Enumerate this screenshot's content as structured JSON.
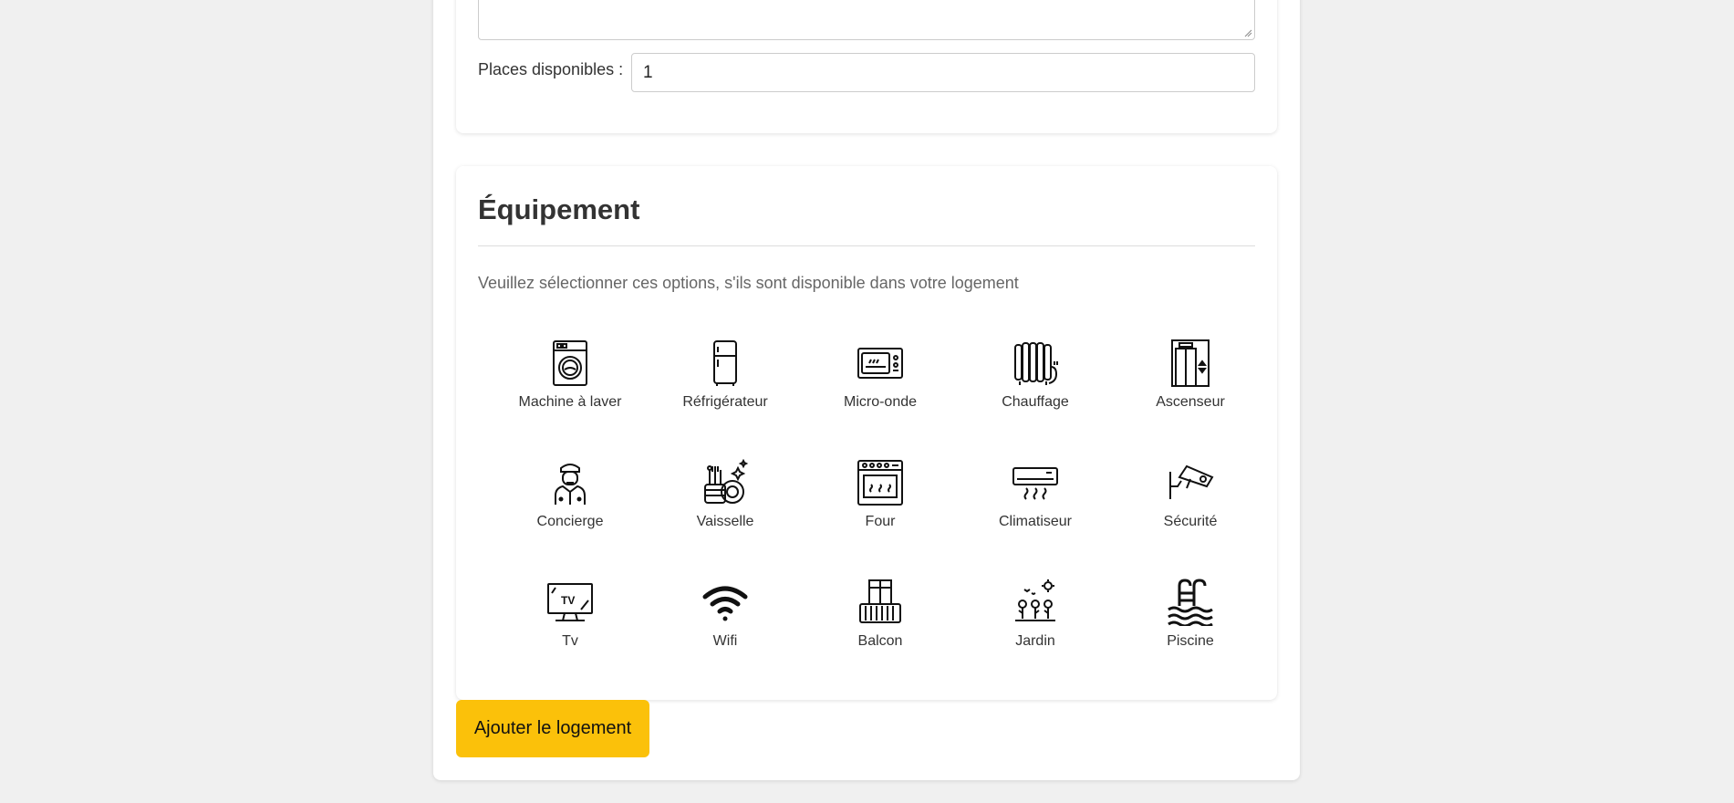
{
  "form": {
    "places_label": "Places disponibles :",
    "places_value": "1"
  },
  "equipment": {
    "title": "Équipement",
    "description": "Veuillez sélectionner ces options, s'ils sont disponible dans votre logement",
    "items": [
      {
        "label": "Machine à laver",
        "icon": "washing-machine-icon"
      },
      {
        "label": "Réfrigérateur",
        "icon": "refrigerator-icon"
      },
      {
        "label": "Micro-onde",
        "icon": "microwave-icon"
      },
      {
        "label": "Chauffage",
        "icon": "radiator-icon"
      },
      {
        "label": "Ascenseur",
        "icon": "elevator-icon"
      },
      {
        "label": "Concierge",
        "icon": "concierge-icon"
      },
      {
        "label": "Vaisselle",
        "icon": "dishes-icon"
      },
      {
        "label": "Four",
        "icon": "oven-icon"
      },
      {
        "label": "Climatiseur",
        "icon": "air-conditioner-icon"
      },
      {
        "label": "Sécurité",
        "icon": "security-camera-icon"
      },
      {
        "label": "Tv",
        "icon": "tv-icon"
      },
      {
        "label": "Wifi",
        "icon": "wifi-icon"
      },
      {
        "label": "Balcon",
        "icon": "balcony-icon"
      },
      {
        "label": "Jardin",
        "icon": "garden-icon"
      },
      {
        "label": "Piscine",
        "icon": "pool-icon"
      }
    ]
  },
  "actions": {
    "submit_label": "Ajouter le logement"
  },
  "colors": {
    "accent": "#fbc10a",
    "background": "#f0f0f0"
  }
}
